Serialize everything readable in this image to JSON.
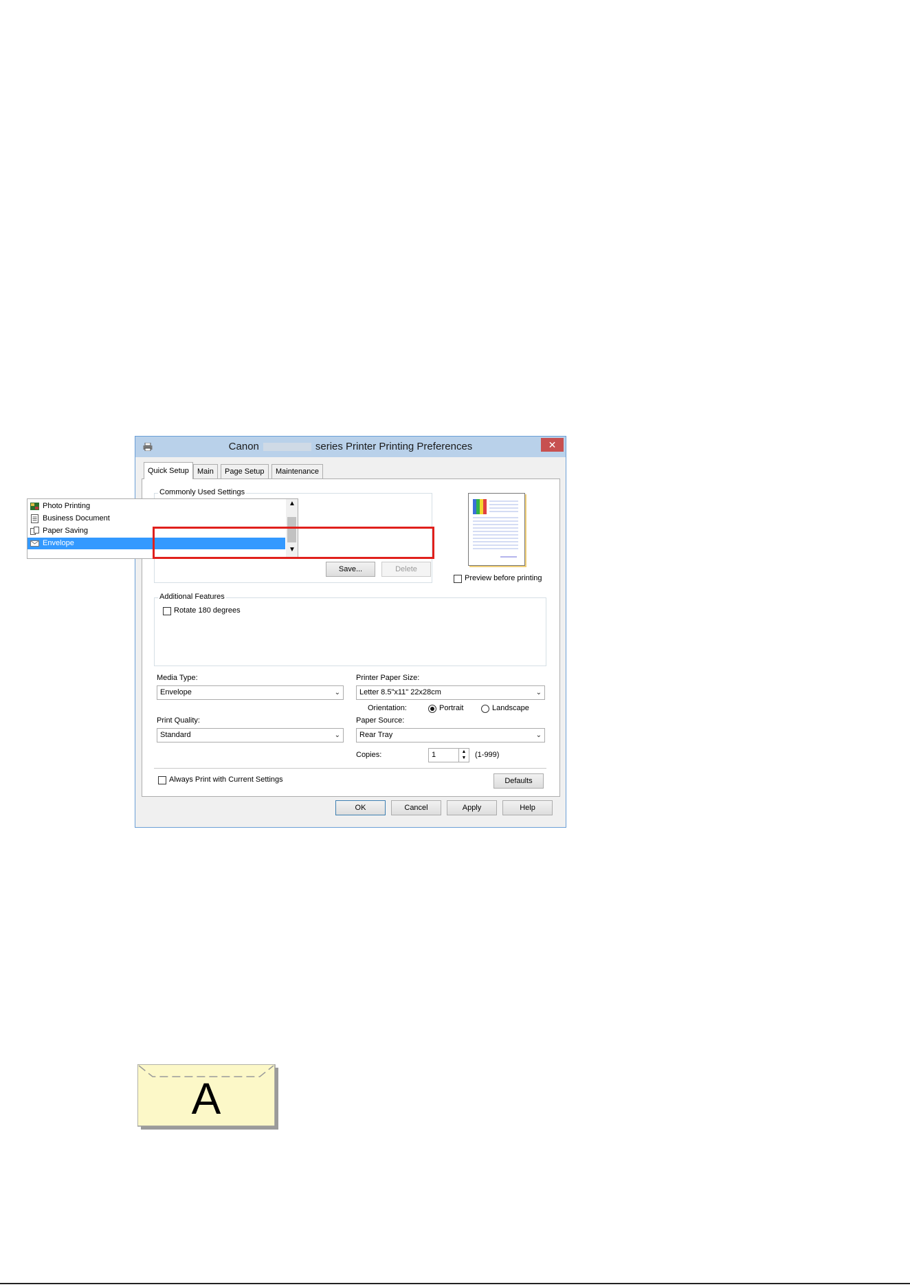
{
  "dialog": {
    "title_prefix": "Canon",
    "title_suffix": "series Printer Printing Preferences",
    "close_label": "✕",
    "tabs": [
      {
        "label": "Quick Setup",
        "active": true
      },
      {
        "label": "Main",
        "active": false
      },
      {
        "label": "Page Setup",
        "active": false
      },
      {
        "label": "Maintenance",
        "active": false
      }
    ],
    "commonly_used": {
      "label": "Commonly Used Settings",
      "items": [
        {
          "label": "Photo Printing",
          "icon": "photo-icon",
          "selected": false
        },
        {
          "label": "Business Document",
          "icon": "document-icon",
          "selected": false
        },
        {
          "label": "Paper Saving",
          "icon": "paper-saving-icon",
          "selected": false
        },
        {
          "label": "Envelope",
          "icon": "envelope-icon",
          "selected": true
        }
      ],
      "save_label": "Save...",
      "delete_label": "Delete"
    },
    "preview_label": "Preview before printing",
    "additional": {
      "label": "Additional Features",
      "items": [
        {
          "label": "Rotate 180 degrees",
          "checked": false
        }
      ]
    },
    "media_type": {
      "label": "Media Type:",
      "value": "Envelope"
    },
    "print_quality": {
      "label": "Print Quality:",
      "value": "Standard"
    },
    "paper_size": {
      "label": "Printer Paper Size:",
      "value": "Letter 8.5\"x11\" 22x28cm"
    },
    "orientation": {
      "label": "Orientation:",
      "portrait": "Portrait",
      "landscape": "Landscape",
      "selected": "portrait"
    },
    "paper_source": {
      "label": "Paper Source:",
      "value": "Rear Tray"
    },
    "copies": {
      "label": "Copies:",
      "value": "1",
      "range": "(1-999)"
    },
    "always_print_label": "Always Print with Current Settings",
    "defaults_label": "Defaults",
    "buttons": {
      "ok": "OK",
      "cancel": "Cancel",
      "apply": "Apply",
      "help": "Help"
    },
    "highlight_color": "#e0201c",
    "selection_color": "#3399ff"
  },
  "envelope_graphic": {
    "letter": "A",
    "fill_color": "#fcf8c8"
  }
}
